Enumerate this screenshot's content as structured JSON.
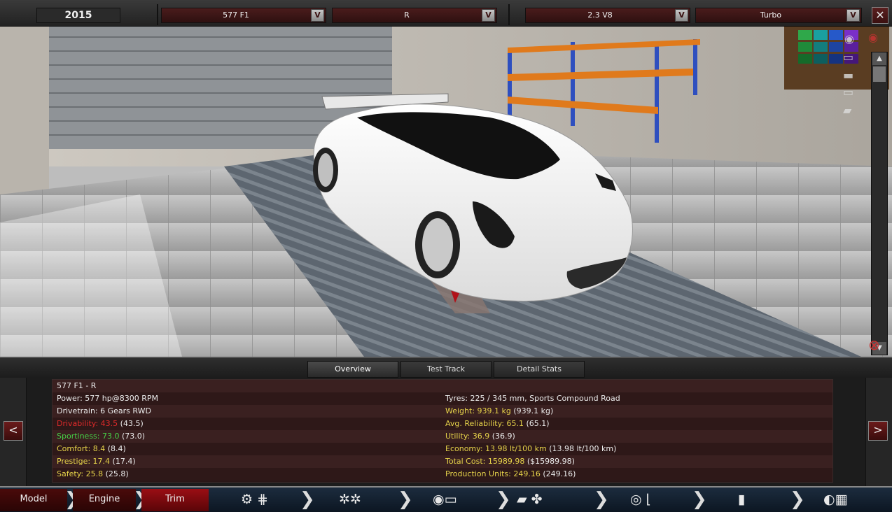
{
  "topbar": {
    "year": "2015",
    "model": "577 F1",
    "trim": "R",
    "engine": "2.3 V8",
    "fuel_system": "Turbo",
    "dropdown_button": "V",
    "close": "✕"
  },
  "tabs": [
    {
      "label": "Overview"
    },
    {
      "label": "Test Track"
    },
    {
      "label": "Detail Stats"
    }
  ],
  "stats": {
    "car_name": "577 F1 - R",
    "power": "Power: 577 hp@8300 RPM",
    "drivetrain": "Drivetrain: 6 Gears RWD",
    "drivability": {
      "value": "Drivability: 43.5",
      "extra": "(43.5)"
    },
    "sportiness": {
      "value": "Sportiness: 73.0",
      "extra": "(73.0)"
    },
    "comfort": {
      "value": "Comfort: 8.4",
      "extra": "(8.4)"
    },
    "prestige": {
      "value": "Prestige: 17.4",
      "extra": "(17.4)"
    },
    "safety": {
      "value": "Safety: 25.8",
      "extra": "(25.8)"
    },
    "tyres": "Tyres: 225 / 345 mm, Sports Compound Road",
    "weight": {
      "value": "Weight: 939.1 kg",
      "extra": "(939.1 kg)"
    },
    "reliability": {
      "value": "Avg. Reliability: 65.1",
      "extra": "(65.1)"
    },
    "utility": {
      "value": "Utility: 36.9",
      "extra": "(36.9)"
    },
    "economy": {
      "value": "Economy: 13.98 lt/100 km",
      "extra": "(13.98 lt/100 km)"
    },
    "total_cost": {
      "value": "Total Cost: 15989.98",
      "extra": "($15989.98)"
    },
    "production_units": {
      "value": "Production Units: 249.16",
      "extra": "(249.16)"
    }
  },
  "nav": {
    "prev": "<",
    "next": ">",
    "items": [
      "Model",
      "Engine",
      "Trim"
    ],
    "chevron": "❯"
  },
  "icons": {
    "camera": "camera-icon",
    "eye": "eye-icon",
    "scroll_up": "▲",
    "scroll_down": "▼",
    "remove": "⊗"
  },
  "colors": {
    "stat_yellow": "#e6d34a",
    "stat_red": "#e02a2a",
    "stat_green": "#46d046",
    "trim_active": "#9a0e14"
  }
}
